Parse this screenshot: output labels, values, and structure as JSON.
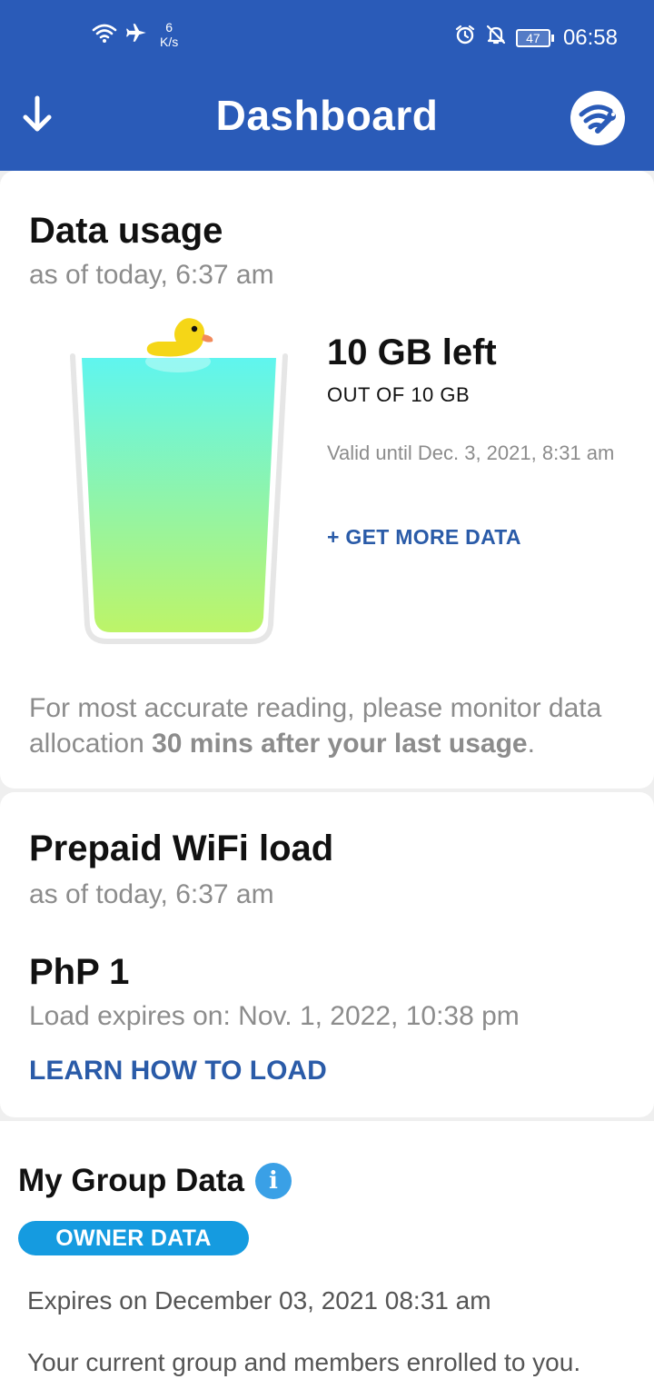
{
  "status_bar": {
    "speed_value": "6",
    "speed_unit": "K/s",
    "battery": "47",
    "time": "06:58"
  },
  "app_bar": {
    "title": "Dashboard"
  },
  "data_usage": {
    "title": "Data usage",
    "as_of": "as of today, 6:37 am",
    "remaining": "10 GB left",
    "total": "OUT OF 10 GB",
    "valid_until": "Valid until Dec. 3, 2021, 8:31 am",
    "get_more": "+ GET MORE DATA",
    "note_prefix": "For most accurate reading, please monitor data allocation ",
    "note_bold": "30 mins after your last usage",
    "note_suffix": ".",
    "fill_fraction": 1.0
  },
  "prepaid": {
    "title": "Prepaid WiFi load",
    "as_of": "as of today, 6:37 am",
    "amount": "PhP 1",
    "expires": "Load expires on: Nov. 1, 2022, 10:38 pm",
    "learn_link": "LEARN HOW TO LOAD"
  },
  "group_data": {
    "title": "My Group Data",
    "badge": "OWNER DATA",
    "expires": "Expires on December 03, 2021 08:31 am",
    "description": "Your current group and members enrolled to you."
  },
  "colors": {
    "brand_blue": "#2a5bb8",
    "link_blue": "#2a5ba8",
    "pill_blue": "#159be0",
    "water_top": "#5ff5ef",
    "water_bottom": "#b9f46a"
  },
  "icons": {
    "back": "arrow-down-icon",
    "wifi_settings": "wifi-wrench-icon",
    "info": "info-icon"
  }
}
